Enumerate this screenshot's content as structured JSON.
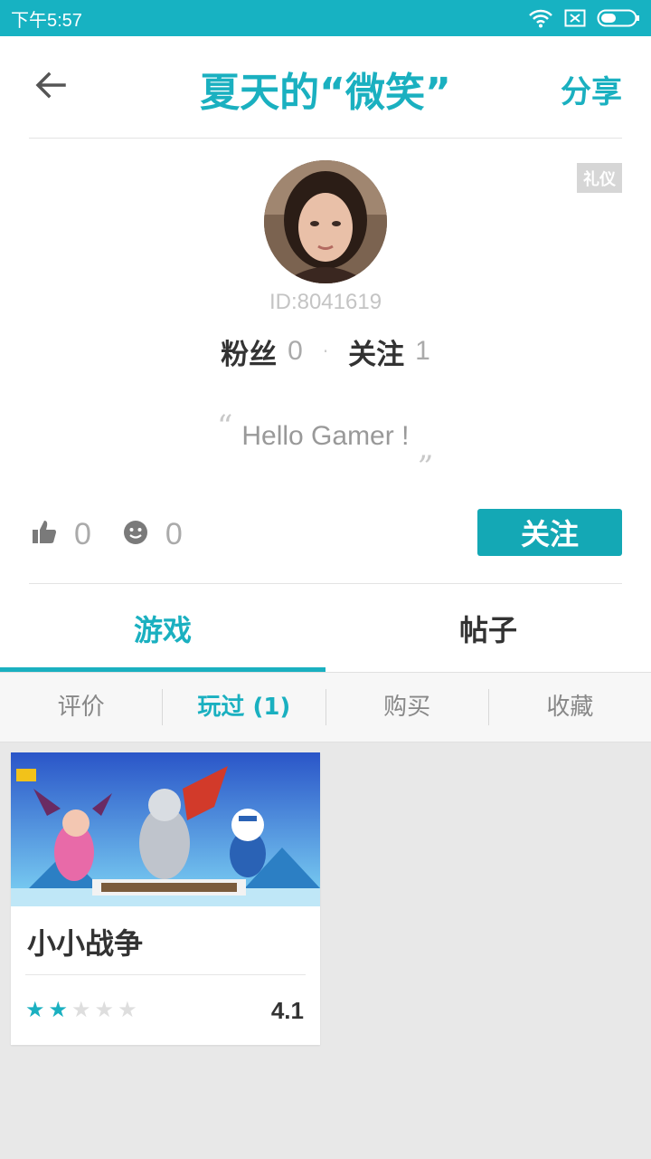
{
  "status_bar": {
    "time": "下午5:57",
    "icons": [
      "wifi-icon",
      "sim-icon",
      "battery-icon"
    ]
  },
  "header": {
    "title": "夏天的“微笑”",
    "share_label": "分享",
    "back_icon": "arrow-left-icon"
  },
  "profile": {
    "badge": "礼仪",
    "user_id": "ID:8041619",
    "fans_label": "粉丝",
    "fans_count": "0",
    "following_label": "关注",
    "following_count": "1",
    "separator": "·",
    "bio_open_quote": "“",
    "bio": "Hello Gamer !",
    "bio_close_quote": "„",
    "likes_count": "0",
    "smiles_count": "0",
    "follow_button": "关注"
  },
  "main_tabs": [
    {
      "label": "游戏",
      "active": true
    },
    {
      "label": "帖子",
      "active": false
    }
  ],
  "sub_tabs": [
    {
      "label": "评价",
      "active": false
    },
    {
      "label": "玩过 (1)",
      "active": true
    },
    {
      "label": "购买",
      "active": false
    },
    {
      "label": "收藏",
      "active": false
    }
  ],
  "games": [
    {
      "title": "小小战争",
      "rating_stars": 2,
      "max_stars": 5,
      "score": "4.1"
    }
  ],
  "colors": {
    "accent": "#1ab0c0",
    "status_bar": "#17b2c2",
    "follow_button": "#14a8b5"
  }
}
